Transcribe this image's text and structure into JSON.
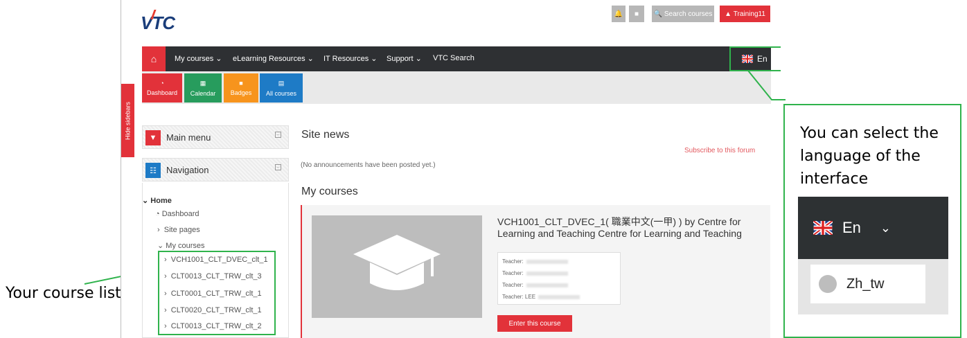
{
  "top": {
    "logo": "VTC",
    "search_label": "Search courses",
    "user_label": "Training11"
  },
  "nav": {
    "items": [
      "My courses",
      "eLearning Resources",
      "IT Resources",
      "Support",
      "VTC Search"
    ],
    "language": "En"
  },
  "toolbar": {
    "items": [
      "Dashboard",
      "Calendar",
      "Badges",
      "All courses"
    ],
    "colors": [
      "#e2323a",
      "#279c5d",
      "#f7941d",
      "#1e7bc6"
    ]
  },
  "hide_sidebars": "Hide sidebars",
  "blocks": {
    "main_menu": "Main menu",
    "navigation": "Navigation"
  },
  "tree": {
    "home": "Home",
    "dashboard": "Dashboard",
    "site_pages": "Site pages",
    "my_courses": "My courses",
    "courses": [
      "VCH1001_CLT_DVEC_clt_1",
      "CLT0013_CLT_TRW_clt_3",
      "CLT0001_CLT_TRW_clt_1",
      "CLT0020_CLT_TRW_clt_1",
      "CLT0013_CLT_TRW_clt_2"
    ]
  },
  "main": {
    "site_news": "Site news",
    "subscribe": "Subscribe to this forum",
    "no_announcements": "(No announcements have been posted yet.)",
    "my_courses": "My courses"
  },
  "course": {
    "title": "VCH1001_CLT_DVEC_1( 職業中文(一甲) ) by Centre for Learning and Teaching Centre for Learning and Teaching",
    "teacher_labels": [
      "Teacher:",
      "Teacher:",
      "Teacher:",
      "Teacher: LEE"
    ],
    "enter_button": "Enter this course"
  },
  "annotations": {
    "course_list": "Your course list",
    "language_note": "You can select the language of the interface",
    "zoom_language": "En",
    "zoom_option": "Zh_tw"
  }
}
